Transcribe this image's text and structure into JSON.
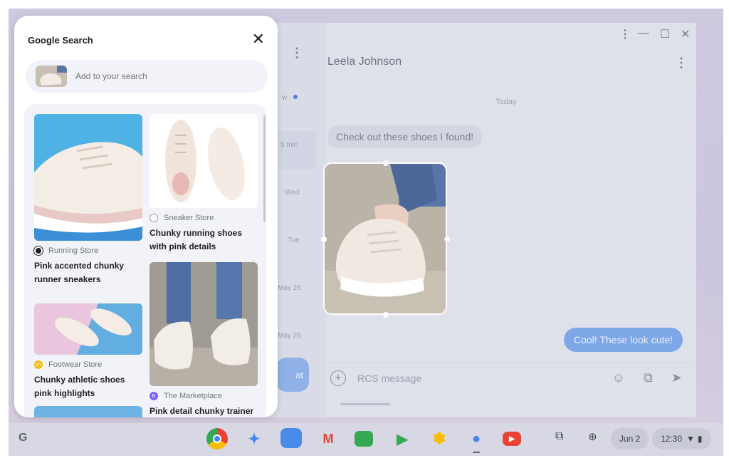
{
  "search_panel": {
    "title": "Google Search",
    "input_placeholder": "Add to your search",
    "results": [
      {
        "store": "Running Store",
        "title": "Pink accented chunky runner sneakers",
        "store_icon_color": "#202124"
      },
      {
        "store": "Sneaker Store",
        "title": "Chunky running shoes with pink details",
        "store_icon_color": "#ffffff"
      },
      {
        "store": "Footwear Store",
        "title": "Chunky athletic shoes pink highlights",
        "store_icon_color": "#fbbc04",
        "store_icon_letter": "sh"
      },
      {
        "store": "The Marketplace",
        "title": "Pink detail chunky trainer",
        "store_icon_color": "#7b61ff",
        "store_icon_letter": "B"
      }
    ]
  },
  "messages": {
    "contact_name": "Leela Johnson",
    "sidebar_times": [
      "w",
      "5 min",
      "Wed",
      "Tue",
      "May 26",
      "May 26"
    ],
    "date_divider": "Today",
    "incoming": "Check out these shoes I found!",
    "outgoing": "Cool! These look cute!",
    "compose_placeholder": "RCS message",
    "fab_label": "at"
  },
  "shelf": {
    "launcher": "G",
    "date": "Jun 2",
    "time": "12:30",
    "apps": [
      "chrome",
      "gemini",
      "files",
      "gmail",
      "meet",
      "play-store",
      "photos",
      "messages",
      "youtube"
    ]
  },
  "colors": {
    "accent_blue": "#7ea7e8",
    "panel_bg": "#ffffff",
    "overlay": "#cfc9e0"
  }
}
